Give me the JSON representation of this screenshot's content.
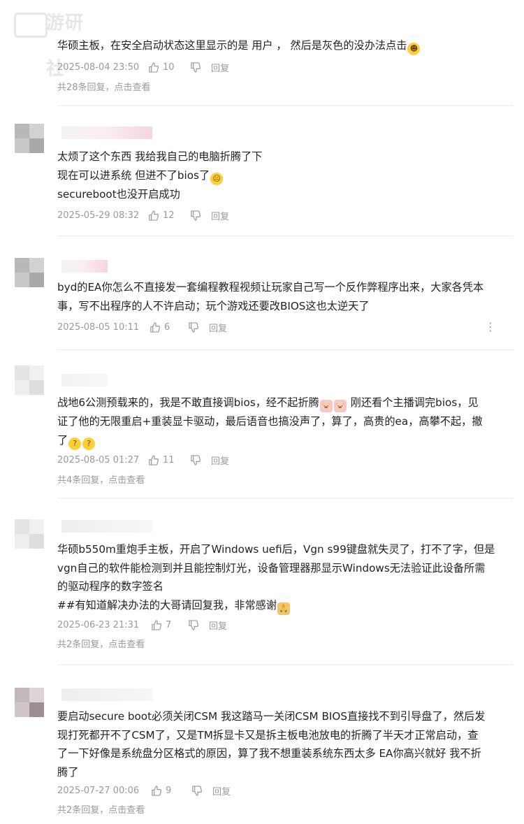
{
  "watermark": {
    "text": "游研社"
  },
  "comments": [
    {
      "lines": [
        "华硕主板，在安全启动状态这里显示的是 用户 ， 然后是灰色的没办法点击"
      ],
      "emoji": [
        "😂"
      ],
      "date": "2025-08-04 23:50",
      "likes": "10",
      "reply_label": "回复",
      "replies": "共28条回复，点击查看"
    },
    {
      "lines": [
        "太烦了这个东西 我给我自己的电脑折腾了下",
        "现在可以进系统 但进不了bios了",
        "secureboot也没开启成功"
      ],
      "emoji": [
        "😫"
      ],
      "date": "2025-05-29 08:32",
      "likes": "12",
      "reply_label": "回复"
    },
    {
      "lines": [
        "byd的EA你怎么不直接发一套编程教程视频让玩家自己写一个反作弊程序出来，大家各凭本",
        "事，写不出程序的人不许启动；玩个游戏还要改BIOS这也太逆天了"
      ],
      "date": "2025-08-05 10:11",
      "likes": "6",
      "reply_label": "回复",
      "more": "⋮"
    },
    {
      "lines": [
        "战地6公测预载来的，我是不敢直接调bios，经不起折腾",
        " 刚还看个主播调完bios，见",
        "证了他的无限重启+重装显卡驱动，最后语音也搞没声了，算了，高贵的ea，高攀不起，撤",
        "了"
      ],
      "emoji": [
        "🐷",
        "🐷",
        "🤔",
        "🤔"
      ],
      "date": "2025-08-05 01:27",
      "likes": "11",
      "reply_label": "回复",
      "replies": "共4条回复，点击查看"
    },
    {
      "lines": [
        "华硕b550m重炮手主板，开启了Windows uefi后，Vgn s99键盘就失灵了，打不了字，但是",
        "vgn自己的软件能检测到并且能控制灯光，设备管理器那显示Windows无法验证此设备所需",
        "的驱动程序的数字签名",
        "##有知道解决办法的大哥请回复我，非常感谢"
      ],
      "emoji": [
        "🙏"
      ],
      "date": "2025-06-23 21:31",
      "likes": "7",
      "reply_label": "回复",
      "replies": "共2条回复，点击查看"
    },
    {
      "lines": [
        "要启动secure boot必须关闭CSM 我这踏马一关闭CSM BIOS直接找不到引导盘了，然后发",
        "现打死都开不了CSM了，又是TM拆显卡又是拆主板电池放电的折腾了半天才正常启动，查",
        "了一下好像是系统盘分区格式的原因，算了我不想重装系统东西太多 EA你高兴就好 我不折",
        "腾了"
      ],
      "date": "2025-07-27 00:06",
      "likes": "9",
      "reply_label": "回复",
      "replies": "共2条回复，点击查看"
    }
  ]
}
